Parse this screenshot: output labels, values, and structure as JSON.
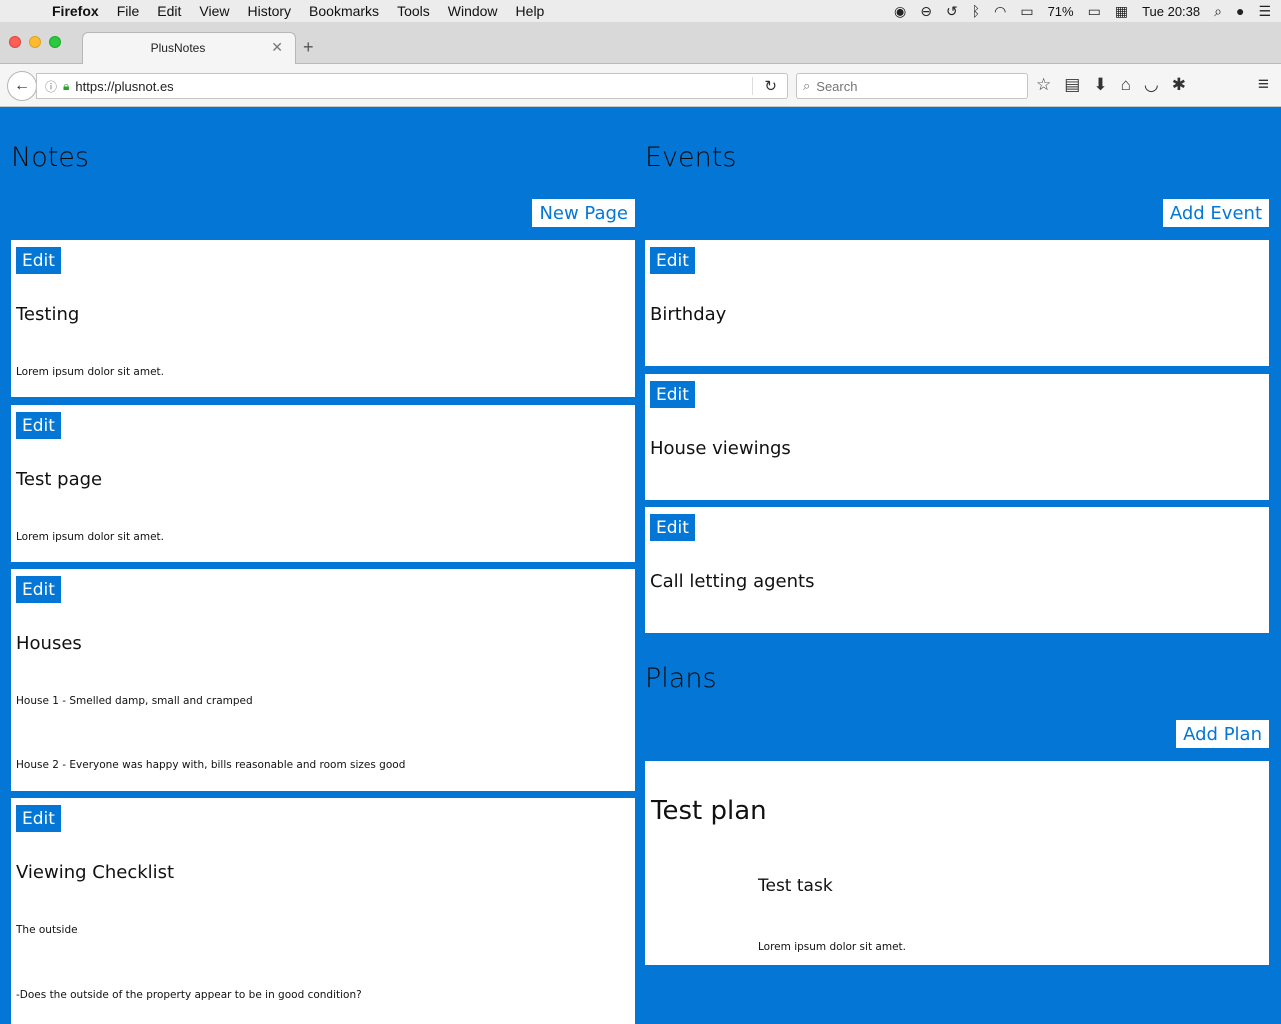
{
  "os_menubar": {
    "app_name": "Firefox",
    "items": [
      "File",
      "Edit",
      "View",
      "History",
      "Bookmarks",
      "Tools",
      "Window",
      "Help"
    ],
    "battery": "71%",
    "clock": "Tue 20:38"
  },
  "browser": {
    "tab_title": "PlusNotes",
    "url": "https://plusnot.es",
    "search_placeholder": "Search"
  },
  "notes": {
    "title": "Notes",
    "new_page_label": "New Page",
    "edit_label": "Edit",
    "items": [
      {
        "title": "Testing",
        "lines": [
          "Lorem ipsum dolor sit amet."
        ]
      },
      {
        "title": "Test page",
        "lines": [
          "Lorem ipsum dolor sit amet."
        ]
      },
      {
        "title": "Houses",
        "lines": [
          "House 1 - Smelled damp, small and cramped",
          "House 2 - Everyone was happy with, bills reasonable and room sizes good"
        ]
      },
      {
        "title": "Viewing Checklist",
        "lines": [
          "The outside",
          "-Does the outside of the property appear to be in good condition?"
        ]
      }
    ]
  },
  "events": {
    "title": "Events",
    "add_label": "Add Event",
    "edit_label": "Edit",
    "items": [
      {
        "title": "Birthday"
      },
      {
        "title": "House viewings"
      },
      {
        "title": "Call letting agents"
      }
    ]
  },
  "plans": {
    "title": "Plans",
    "add_label": "Add Plan",
    "items": [
      {
        "title": "Test plan",
        "task_title": "Test task",
        "task_text": "Lorem ipsum dolor sit amet."
      }
    ]
  }
}
